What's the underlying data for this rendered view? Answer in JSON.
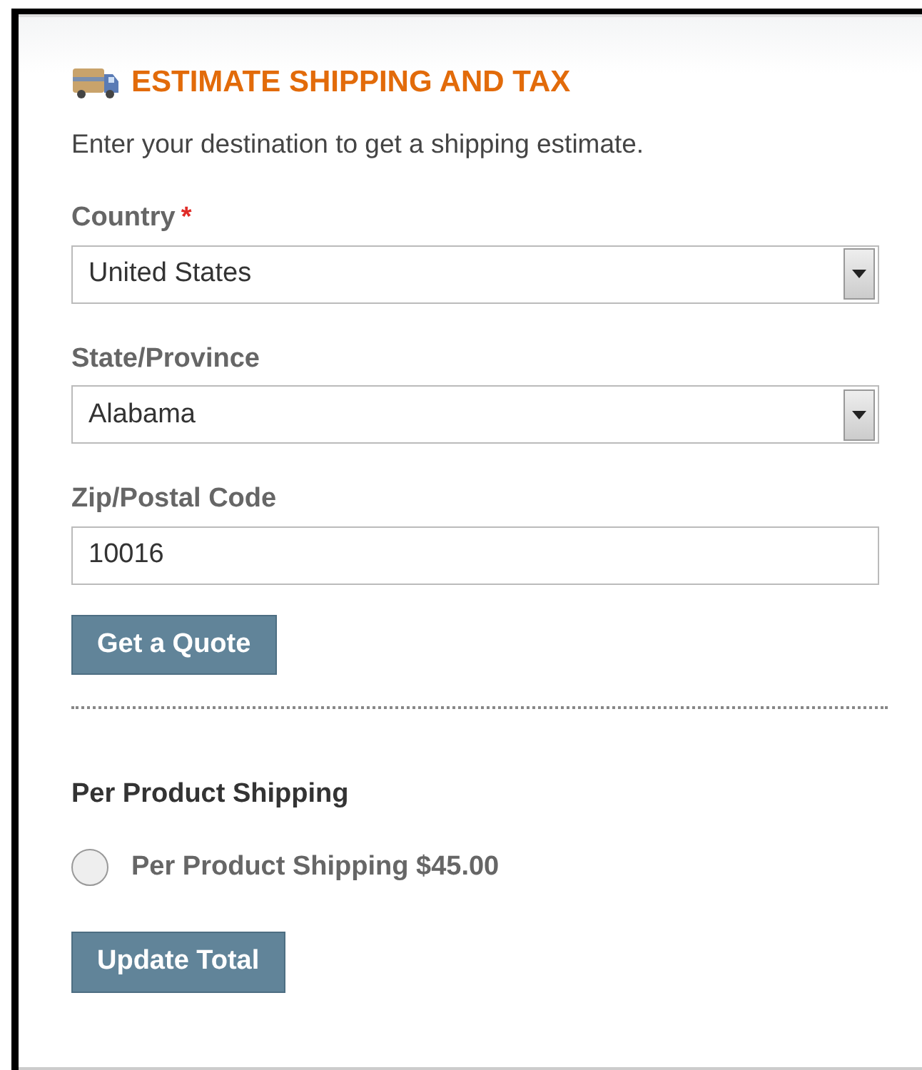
{
  "title": "ESTIMATE SHIPPING AND TAX",
  "intro": "Enter your destination to get a shipping estimate.",
  "fields": [
    {
      "kind": "select",
      "label": "Country",
      "required_mark": "*",
      "value": "United States"
    },
    {
      "kind": "select",
      "label": "State/Province",
      "value": "Alabama"
    },
    {
      "kind": "text",
      "label": "Zip/Postal Code",
      "value": "10016"
    }
  ],
  "quote_button": "Get a Quote",
  "method": {
    "heading": "Per Product Shipping",
    "options": [
      {
        "label": "Per Product Shipping $45.00",
        "selected": false
      }
    ]
  },
  "update_button": "Update Total"
}
